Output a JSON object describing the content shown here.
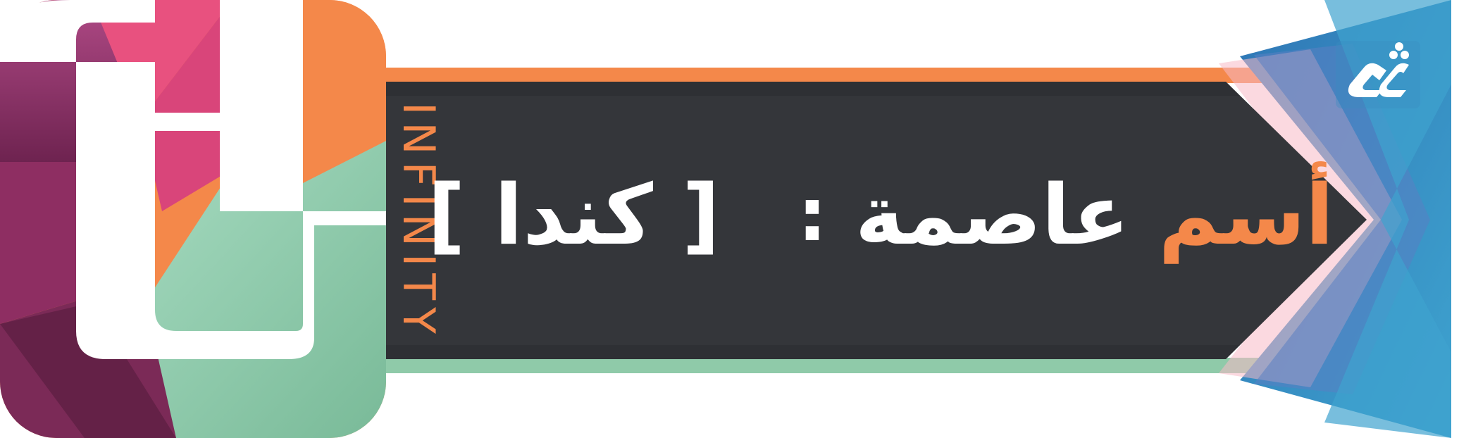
{
  "brand": {
    "wordmark": "INFINITY",
    "logo_letters": "it",
    "corner_logo_icon": "ed-brand-icon"
  },
  "card": {
    "question_word_1": "أسم",
    "question_word_2": "عاصمة",
    "colon": ":",
    "answer": "[ كندا ]"
  },
  "colors": {
    "orange": "#f4884a",
    "mint": "#8fcaa9",
    "magenta": "#a0336f",
    "pink": "#e8517f",
    "dark_panel": "#34363a",
    "blue": "#3a8cc0"
  }
}
